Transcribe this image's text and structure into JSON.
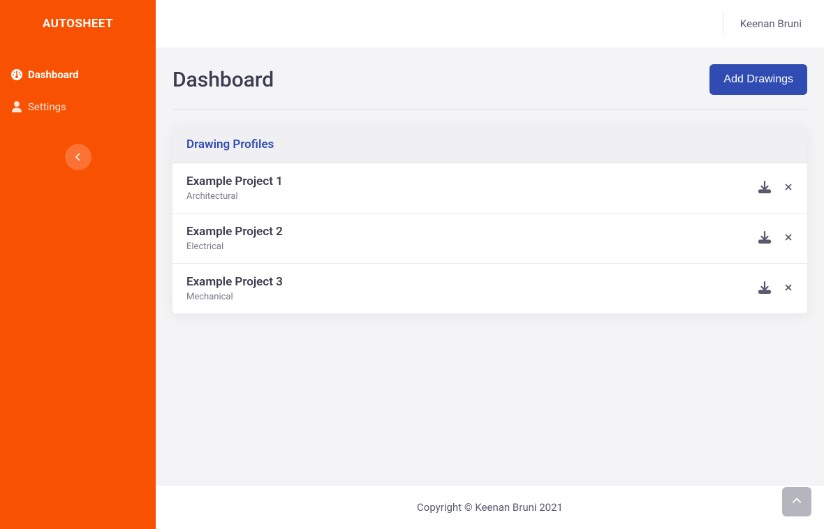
{
  "brand": "AUTOSHEET",
  "sidebar": {
    "items": [
      {
        "label": "Dashboard"
      },
      {
        "label": "Settings"
      }
    ]
  },
  "topbar": {
    "user_name": "Keenan Bruni"
  },
  "page": {
    "title": "Dashboard",
    "add_button_label": "Add Drawings"
  },
  "card": {
    "title": "Drawing Profiles",
    "items": [
      {
        "name": "Example Project 1",
        "subtype": "Architectural"
      },
      {
        "name": "Example Project 2",
        "subtype": "Electrical"
      },
      {
        "name": "Example Project 3",
        "subtype": "Mechanical"
      }
    ]
  },
  "footer": {
    "copyright": "Copyright © Keenan Bruni 2021"
  }
}
